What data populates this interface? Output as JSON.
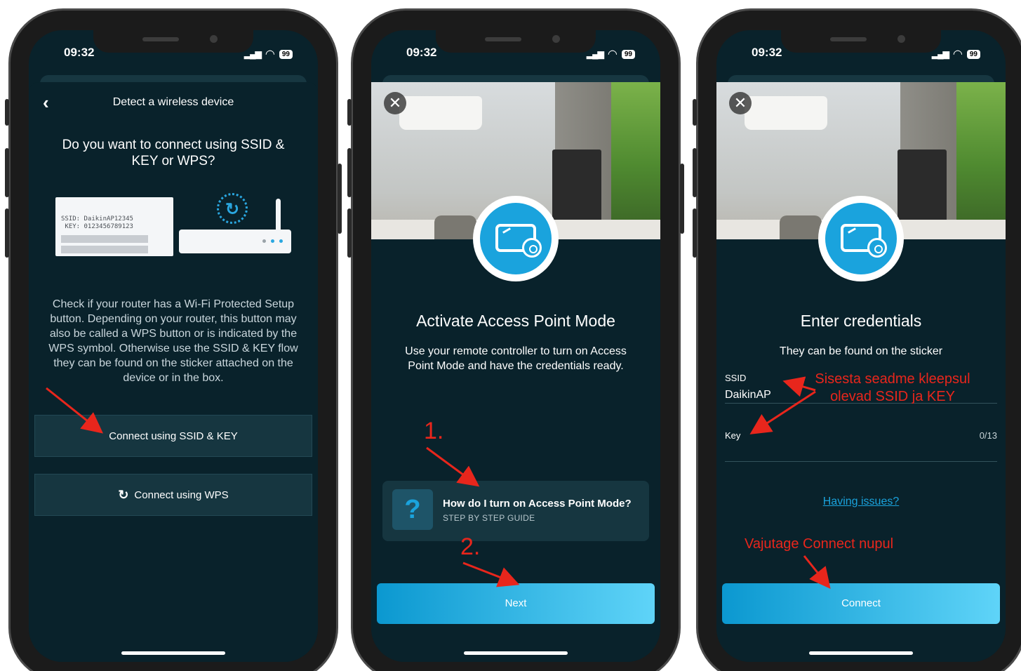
{
  "status": {
    "time": "09:32",
    "battery": "99",
    "signal_glyph": "▂▄▆",
    "wifi_glyph": "◠"
  },
  "screen1": {
    "nav_title": "Detect a wireless device",
    "back_glyph": "‹",
    "heading": "Do you want to connect using SSID & KEY or WPS?",
    "sticker_text": "SSID: DaikinAP12345\n KEY: 0123456789123",
    "wps_glyph": "↻",
    "body": "Check if your router has a Wi-Fi Protected Setup button. Depending on your router, this button may also be called a WPS button or is indicated by the WPS symbol. Otherwise use the SSID & KEY flow they can be found on the sticker attached on the device or in the box.",
    "btn_ssid": "Connect using SSID & KEY",
    "btn_wps": "Connect using WPS",
    "btn_wps_icon": "↻"
  },
  "screen2": {
    "close_glyph": "✕",
    "title": "Activate Access Point Mode",
    "description": "Use your remote controller to turn on Access Point Mode and have the credentials ready.",
    "guide_icon": "?",
    "guide_title": "How do I turn on Access Point Mode?",
    "guide_sub": "STEP BY STEP GUIDE",
    "next": "Next"
  },
  "screen3": {
    "close_glyph": "✕",
    "title": "Enter credentials",
    "subtitle": "They can be found on the sticker",
    "ssid_label": "SSID",
    "ssid_value": "DaikinAP",
    "key_label": "Key",
    "key_counter": "0/13",
    "issues_link": "Having issues?",
    "connect": "Connect"
  },
  "annotations": {
    "step1": "1.",
    "step2": "2.",
    "sticker_note_line1": "Sisesta seadme kleepsul",
    "sticker_note_line2": "olevad SSID ja KEY",
    "connect_note": "Vajutage Connect nupul"
  },
  "colors": {
    "background": "#09222b",
    "accent": "#1aa3dd",
    "annotation": "#e8261c",
    "button_surface": "#163640"
  }
}
